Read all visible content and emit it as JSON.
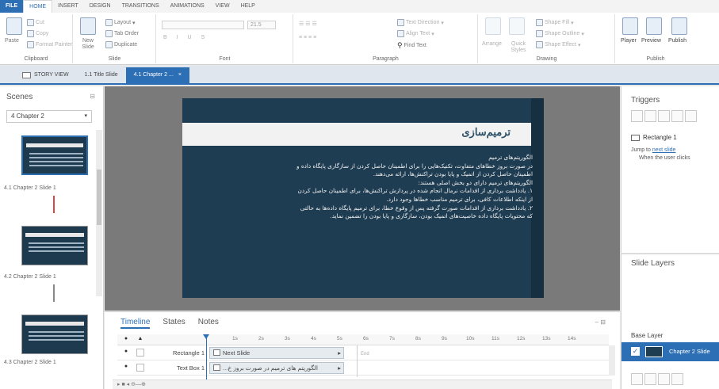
{
  "ribbon": {
    "tabs": [
      "FILE",
      "HOME",
      "INSERT",
      "DESIGN",
      "TRANSITIONS",
      "ANIMATIONS",
      "VIEW",
      "HELP"
    ],
    "active_tab": "HOME",
    "clipboard": {
      "paste": "Paste",
      "cut": "Cut",
      "copy": "Copy",
      "format_painter": "Format Painter",
      "label": "Clipboard"
    },
    "slide": {
      "new_slide": "New Slide",
      "layout": "Layout",
      "tab_order": "Tab Order",
      "duplicate": "Duplicate",
      "label": "Slide"
    },
    "font": {
      "label": "Font",
      "size": "21.5"
    },
    "paragraph": {
      "text_direction": "Text Direction",
      "align_text": "Align Text",
      "find_text": "Find Text",
      "label": "Paragraph"
    },
    "drawing": {
      "arrange": "Arrange",
      "quick_styles": "Quick Styles",
      "shape_fill": "Shape Fill",
      "shape_outline": "Shape Outline",
      "shape_effect": "Shape Effect",
      "label": "Drawing"
    },
    "publish": {
      "player": "Player",
      "preview": "Preview",
      "publish": "Publish",
      "label": "Publish"
    }
  },
  "doc_tabs": [
    "STORY VIEW",
    "1.1 Title Slide",
    "4.1 Chapter 2 ..."
  ],
  "scenes": {
    "title": "Scenes",
    "selected_scene": "4 Chapter 2",
    "slides": [
      "4.1 Chapter 2 Slide 1",
      "4.2 Chapter 2 Slide 1",
      "4.3 Chapter 2 Slide 1"
    ]
  },
  "slide": {
    "title": "ترمیم‌سازی",
    "body": [
      "الگوریتم‌های ترمیم",
      "در صورت بروز خطاهای متفاوت، تکنیک‌هایی را برای اطمینان حاصل کردن از سازگاری پایگاه داده و",
      "اطمینان حاصل کردن از اتمیک و پایا بودن تراکنش‌ها، ارائه می‌دهند.",
      "الگوریتم‌های ترمیم دارای دو بخش اصلی هستند:",
      "۱. یادداشت برداری از اقدامات نرمال انجام شده در پردازش تراکنش‌ها، برای اطمینان حاصل کردن",
      "از اینکه اطلاعات کافی، برای ترمیم مناسب خطاها وجود دارد.",
      "۲. یادداشت برداری از اقدامات صورت گرفته پس از وقوع خطا، برای ترمیم پایگاه داده‌ها به حالتی",
      "که محتویات پایگاه داده خاصیت‌های اتمیک بودن، سازگاری و پایا بودن را تضمین نماید."
    ]
  },
  "timeline": {
    "tabs": [
      "Timeline",
      "States",
      "Notes"
    ],
    "active_tab": "Timeline",
    "ticks": [
      "1s",
      "2s",
      "3s",
      "4s",
      "5s",
      "6s",
      "7s",
      "8s",
      "9s",
      "10s",
      "11s",
      "12s",
      "13s",
      "14s"
    ],
    "end_label": "End",
    "rows": [
      {
        "name": "Rectangle 1",
        "bar": "Next Slide"
      },
      {
        "name": "Text Box 1",
        "bar": "...الگوریتم های ترمیم در صورت بروز خ"
      }
    ]
  },
  "triggers": {
    "title": "Triggers",
    "item": "Rectangle 1",
    "action_prefix": "Jump to",
    "action_link": "next slide",
    "condition": "When the user clicks"
  },
  "layers": {
    "title": "Slide Layers",
    "base_label": "Base Layer",
    "base_name": "Chapter 2 Slide"
  }
}
